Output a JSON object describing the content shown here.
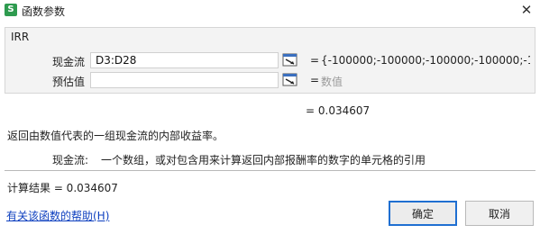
{
  "window": {
    "title": "函数参数",
    "app_icon": "S",
    "close_glyph": "✕"
  },
  "function_name": "IRR",
  "params": [
    {
      "label": "现金流",
      "value": "D3:D28",
      "placeholder": "",
      "preview": "{-100000;-100000;-100000;-100000;-1..."
    },
    {
      "label": "预估值",
      "value": "",
      "placeholder": "",
      "preview": "数值"
    }
  ],
  "eq_sign": "=",
  "function_result": "= 0.034607",
  "function_description": "返回由数值代表的一组现金流的内部收益率。",
  "param_help": {
    "name": "现金流:",
    "text": "一个数组，或对包含用来计算返回内部报酬率的数字的单元格的引用"
  },
  "calc_result": "计算结果 = 0.034607",
  "help_link": "有关该函数的帮助(H)",
  "buttons": {
    "ok": "确定",
    "cancel": "取消"
  },
  "colors": {
    "accent": "#1f6fd1",
    "link": "#0d3fbf",
    "app_icon": "#2e9b4f"
  }
}
